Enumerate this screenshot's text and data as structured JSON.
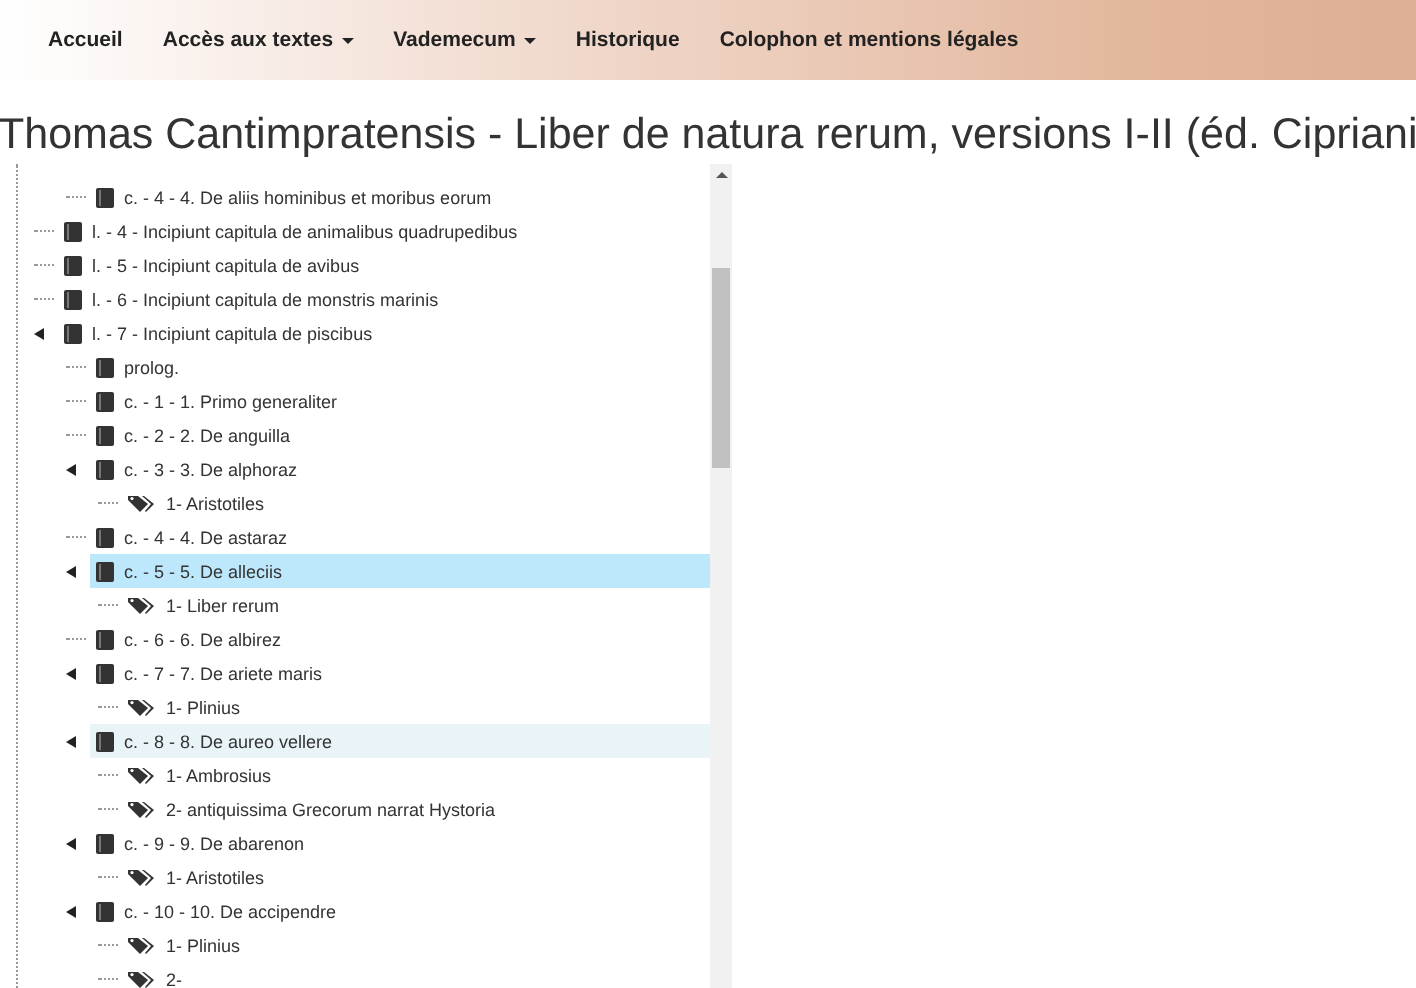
{
  "navbar": {
    "items": [
      {
        "label": "Accueil",
        "dropdown": false
      },
      {
        "label": "Accès aux textes",
        "dropdown": true
      },
      {
        "label": "Vademecum",
        "dropdown": true
      },
      {
        "label": "Historique",
        "dropdown": false
      },
      {
        "label": "Colophon et mentions légales",
        "dropdown": false
      }
    ]
  },
  "title": "Thomas Cantimpratensis - Liber de natura rerum, versions I-II (éd. Cipriani",
  "tree": {
    "continued_items": [
      {
        "kind": "book",
        "label": "c. - 4 - 4. De aliis hominibus et moribus eorum",
        "expanded": false,
        "selected": false,
        "hovered": false
      }
    ],
    "nodes": [
      {
        "kind": "book",
        "label": "l. - 4 - Incipiunt capitula de animalibus quadrupedibus",
        "expanded": false,
        "selected": false,
        "hovered": false
      },
      {
        "kind": "book",
        "label": "l. - 5 - Incipiunt capitula de avibus",
        "expanded": false,
        "selected": false,
        "hovered": false
      },
      {
        "kind": "book",
        "label": "l. - 6 - Incipiunt capitula de monstris marinis",
        "expanded": false,
        "selected": false,
        "hovered": false
      },
      {
        "kind": "book",
        "label": "l. - 7 - Incipiunt capitula de piscibus",
        "expanded": true,
        "selected": false,
        "hovered": false,
        "children": [
          {
            "kind": "book",
            "label": "prolog.",
            "expanded": false,
            "selected": false,
            "hovered": false
          },
          {
            "kind": "book",
            "label": "c. - 1 - 1. Primo generaliter",
            "expanded": false,
            "selected": false,
            "hovered": false
          },
          {
            "kind": "book",
            "label": "c. - 2 - 2. De anguilla",
            "expanded": false,
            "selected": false,
            "hovered": false
          },
          {
            "kind": "book",
            "label": "c. - 3 - 3. De alphoraz",
            "expanded": true,
            "selected": false,
            "hovered": false,
            "children": [
              {
                "kind": "tag",
                "label": "1- Aristotiles",
                "selected": false,
                "hovered": false
              }
            ]
          },
          {
            "kind": "book",
            "label": "c. - 4 - 4. De astaraz",
            "expanded": false,
            "selected": false,
            "hovered": false
          },
          {
            "kind": "book",
            "label": "c. - 5 - 5. De alleciis",
            "expanded": true,
            "selected": true,
            "hovered": false,
            "children": [
              {
                "kind": "tag",
                "label": "1- Liber rerum",
                "selected": false,
                "hovered": false
              }
            ]
          },
          {
            "kind": "book",
            "label": "c. - 6 - 6. De albirez",
            "expanded": false,
            "selected": false,
            "hovered": false
          },
          {
            "kind": "book",
            "label": "c. - 7 - 7. De ariete maris",
            "expanded": true,
            "selected": false,
            "hovered": false,
            "children": [
              {
                "kind": "tag",
                "label": "1- Plinius",
                "selected": false,
                "hovered": false
              }
            ]
          },
          {
            "kind": "book",
            "label": "c. - 8 - 8. De aureo vellere",
            "expanded": true,
            "selected": false,
            "hovered": true,
            "children": [
              {
                "kind": "tag",
                "label": "1- Ambrosius",
                "selected": false,
                "hovered": false
              },
              {
                "kind": "tag",
                "label": "2- antiquissima Grecorum narrat Hystoria",
                "selected": false,
                "hovered": false
              }
            ]
          },
          {
            "kind": "book",
            "label": "c. - 9 - 9. De abarenon",
            "expanded": true,
            "selected": false,
            "hovered": false,
            "children": [
              {
                "kind": "tag",
                "label": "1- Aristotiles",
                "selected": false,
                "hovered": false
              }
            ]
          },
          {
            "kind": "book",
            "label": "c. - 10 - 10. De accipendre",
            "expanded": true,
            "selected": false,
            "hovered": false,
            "children": [
              {
                "kind": "tag",
                "label": "1- Plinius",
                "selected": false,
                "hovered": false
              },
              {
                "kind": "tag",
                "label": "2-",
                "selected": false,
                "hovered": false
              }
            ]
          }
        ]
      }
    ]
  }
}
